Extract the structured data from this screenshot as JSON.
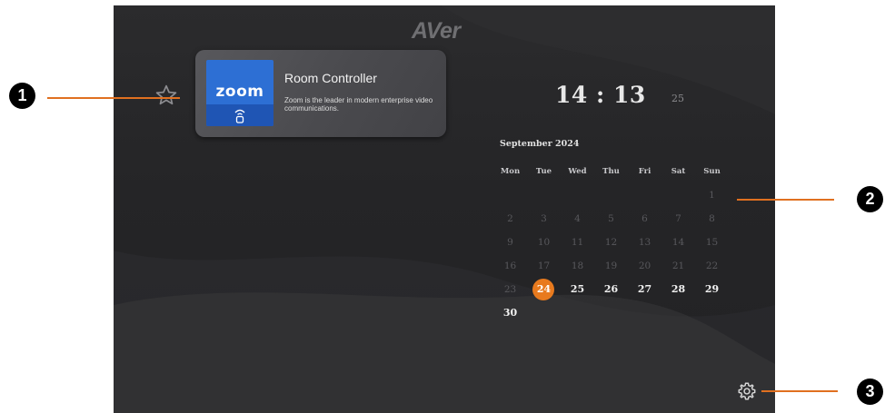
{
  "brand": {
    "logo_text": "AVer"
  },
  "favorite": {
    "icon": "star-icon"
  },
  "app_card": {
    "app_name": "zoom",
    "title": "Room Controller",
    "description": "Zoom is the leader in modern enterprise video communications.",
    "tile_color": "#2d6fd4",
    "icon": "remote-signal-icon"
  },
  "clock": {
    "hours": "14",
    "separator": ":",
    "minutes": "13",
    "seconds": "25"
  },
  "calendar": {
    "month_label": "September 2024",
    "weekdays": [
      "Mon",
      "Tue",
      "Wed",
      "Thu",
      "Fri",
      "Sat",
      "Sun"
    ],
    "weeks": [
      [
        "",
        "",
        "",
        "",
        "",
        "",
        "1"
      ],
      [
        "2",
        "3",
        "4",
        "5",
        "6",
        "7",
        "8"
      ],
      [
        "9",
        "10",
        "11",
        "12",
        "13",
        "14",
        "15"
      ],
      [
        "16",
        "17",
        "18",
        "19",
        "20",
        "21",
        "22"
      ],
      [
        "23",
        "24",
        "25",
        "26",
        "27",
        "28",
        "29"
      ],
      [
        "30",
        "",
        "",
        "",
        "",
        "",
        ""
      ]
    ],
    "today": "24",
    "accent_color": "#e87a1e"
  },
  "settings": {
    "icon": "gear-icon"
  },
  "callouts": [
    {
      "number": "1"
    },
    {
      "number": "2"
    },
    {
      "number": "3"
    }
  ]
}
